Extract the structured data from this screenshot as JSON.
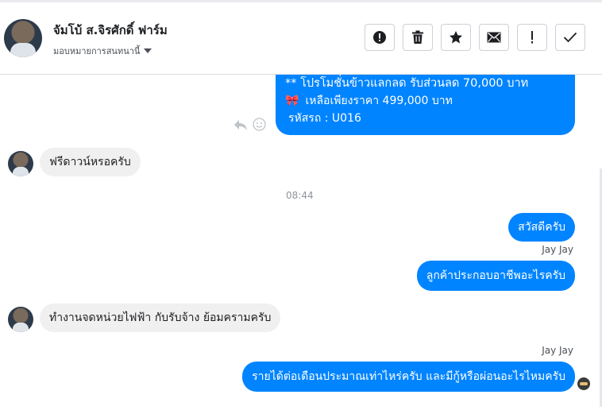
{
  "header": {
    "name": "จัมโบ้ ส.จิรศักดิ์ ฟาร์ม",
    "subtitle": "มอบหมายการสนทนานี้",
    "buttons": [
      {
        "name": "report-button",
        "icon": "alert-circle-icon"
      },
      {
        "name": "delete-button",
        "icon": "trash-icon"
      },
      {
        "name": "star-button",
        "icon": "star-icon"
      },
      {
        "name": "mark-unread-button",
        "icon": "envelope-icon"
      },
      {
        "name": "spam-button",
        "icon": "exclamation-icon"
      },
      {
        "name": "done-button",
        "icon": "checkmark-icon"
      }
    ]
  },
  "messages": {
    "promo_line1": "** โปรโมชั่นข้าวแลกลด รับส่วนลด 70,000 บาท",
    "promo_emoji": "🎀",
    "promo_line2": "เหลือเพียงราคา 499,000 บาท",
    "promo_line3": "รหัสรถ : U016",
    "in_1": "ฟรีดาวน์หรอครับ",
    "time_1": "08:44",
    "out_1": "สวัสดีครับ",
    "sender_1": "Jay Jay",
    "out_2": "ลูกค้าประกอบอาชีพอะไรครับ",
    "in_2": "ทำงานจดหน่วยไฟฟ้า กับรับจ้าง ย้อมครามครับ",
    "sender_2": "Jay Jay",
    "out_3": "รายได้ต่อเดือนประมาณเท่าไหร่ครับ และมีกู้หรือผ่อนอะไรไหมครับ"
  },
  "colors": {
    "outgoing_bubble": "#0084ff",
    "incoming_bubble": "#f1f0f0"
  }
}
